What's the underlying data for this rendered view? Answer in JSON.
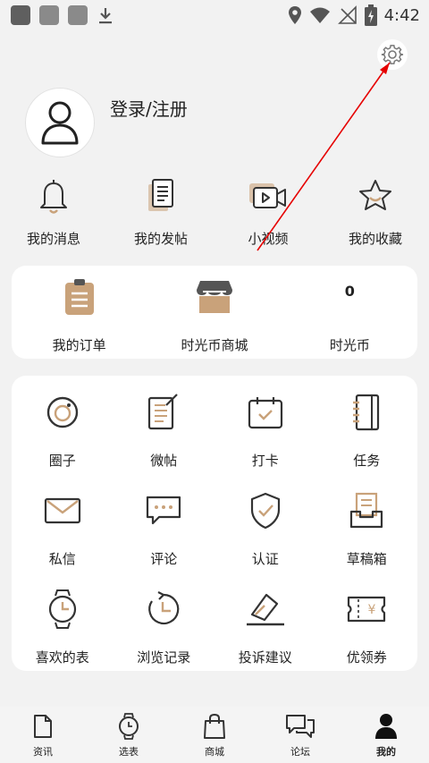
{
  "status_bar": {
    "time": "4:42"
  },
  "profile": {
    "login_label": "登录/注册"
  },
  "quick_actions": [
    {
      "label": "我的消息"
    },
    {
      "label": "我的发帖"
    },
    {
      "label": "小视频"
    },
    {
      "label": "我的收藏"
    }
  ],
  "shop_card": {
    "orders_label": "我的订单",
    "mall_label": "时光币商城",
    "coin_value": "0",
    "coin_label": "时光币"
  },
  "grid": [
    {
      "label": "圈子"
    },
    {
      "label": "微帖"
    },
    {
      "label": "打卡"
    },
    {
      "label": "任务"
    },
    {
      "label": "私信"
    },
    {
      "label": "评论"
    },
    {
      "label": "认证"
    },
    {
      "label": "草稿箱"
    },
    {
      "label": "喜欢的表"
    },
    {
      "label": "浏览记录"
    },
    {
      "label": "投诉建议"
    },
    {
      "label": "优领券"
    }
  ],
  "tabs": [
    {
      "label": "资讯"
    },
    {
      "label": "选表"
    },
    {
      "label": "商城"
    },
    {
      "label": "论坛"
    },
    {
      "label": "我的"
    }
  ],
  "colors": {
    "accent_brown": "#c9a27a",
    "annotation_red": "#e60000"
  }
}
